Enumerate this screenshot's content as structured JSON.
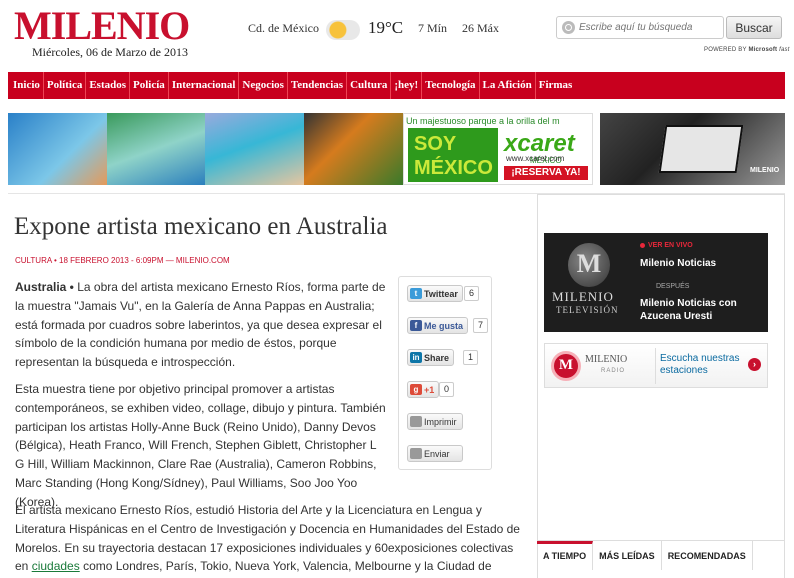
{
  "header": {
    "logo": "MILENIO",
    "date": "Miércoles, 06 de Marzo de 2013",
    "city": "Cd. de México",
    "temp": "19°C",
    "min": "7 Mín",
    "max": "26 Máx",
    "search_placeholder": "Escribe aquí tu búsqueda",
    "search_button": "Buscar",
    "powered_prefix": "POWERED BY",
    "powered_brand": "Microsoft",
    "powered_suffix": "fast"
  },
  "nav": [
    "Inicio",
    "Política",
    "Estados",
    "Policía",
    "Internacional",
    "Negocios",
    "Tendencias",
    "Cultura",
    "¡hey!",
    "Tecnología",
    "La Afición",
    "Firmas"
  ],
  "ads": {
    "xcaret_tagline": "Un majestuoso parque a la orilla del m",
    "xcaret_soy": "SOY MÉXICO",
    "xcaret_logo": "xcaret",
    "xcaret_mexico": "MÉXICO",
    "xcaret_url": "www.xcaret.com",
    "xcaret_cta": "¡RESERVA YA!",
    "promo_brand": "MILENIO"
  },
  "article": {
    "title": "Expone artista mexicano en Australia",
    "meta": "CULTURA • 18 FEBRERO 2013 - 6:09PM — MILENIO.COM",
    "p1_lead": "Australia •",
    "p1": " La obra del artista mexicano Ernesto Ríos, forma parte de la muestra \"Jamais Vu\", en la Galería de Anna Pappas en Australia; está formada por cuadros sobre laberintos, ya que desea expresar el símbolo de la condición humana por medio de éstos, porque  representan la búsqueda e introspección.",
    "p2": "Esta muestra tiene por objetivo principal promover a artistas contemporáneos, se exhiben video, collage, dibujo y pintura. También participan los artistas Holly-Anne Buck (Reino Unido), Danny Devos (Bélgica), Heath Franco, Will French, Stephen Giblett, Christopher L G Hill, William Mackinnon, Clare Rae (Australia), Cameron Robbins, Marc Standing (Hong Kong/Sídney), Paul Williams, Soo Joo Yoo (Korea).",
    "p3_a": "El artista mexicano Ernesto Ríos, estudió Historia del Arte y la Licenciatura en Lengua y Literatura Hispánicas en el Centro de Investigación y Docencia en Humanidades del Estado de Morelos. En su trayectoria destacan 17 exposiciones individuales y 60exposiciones colectivas en ",
    "p3_link": "ciudades",
    "p3_b": " como Londres, París, Tokio, Nueva York, Valencia, Melbourne y la Ciudad de México"
  },
  "share": {
    "tweet": "Twittear",
    "tweet_count": "6",
    "like": "Me gusta",
    "like_count": "7",
    "linkedin": "Share",
    "linkedin_count": "1",
    "gplus": "+1",
    "gplus_count": "0",
    "print": "Imprimir",
    "send": "Enviar"
  },
  "sidebar": {
    "tv_word": "MILENIO",
    "tv_sub": "TELEVISIÓN",
    "live_label": "VER EN VIVO",
    "now_show": "Milenio Noticias",
    "after_label": "DESPUÉS",
    "next_show": "Milenio Noticias con Azucena Uresti",
    "radio_name": "MILENIO",
    "radio_sub": "RADIO",
    "radio_cta": "Escucha nuestras estaciones",
    "tabs": [
      "A TIEMPO",
      "MÁS LEÍDAS",
      "RECOMENDADAS"
    ]
  },
  "colors": {
    "brand_red": "#c8102e",
    "link_green": "#1a7a3a"
  }
}
